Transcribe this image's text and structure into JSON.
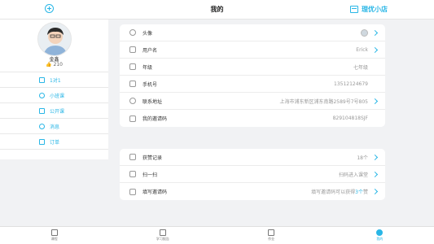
{
  "header": {
    "title": "我的",
    "shop_label": "理优小店"
  },
  "profile": {
    "name": "金鑫",
    "likes": "210"
  },
  "menu": [
    {
      "label": "1对1",
      "icon": "people-icon"
    },
    {
      "label": "小班课",
      "icon": "group-icon"
    },
    {
      "label": "公开课",
      "icon": "broadcast-icon"
    },
    {
      "label": "消息",
      "icon": "chat-icon"
    },
    {
      "label": "订单",
      "icon": "order-icon"
    }
  ],
  "info_rows": [
    {
      "label": "头像",
      "value": "",
      "icon": "user-icon"
    },
    {
      "label": "用户名",
      "value": "Erick",
      "icon": "id-card-icon"
    },
    {
      "label": "年级",
      "value": "七年级",
      "icon": "grade-icon"
    },
    {
      "label": "手机号",
      "value": "13512124679",
      "icon": "phone-icon"
    },
    {
      "label": "联系地址",
      "value": "上海市浦东新区浦东南路2589号7号805",
      "icon": "location-icon"
    },
    {
      "label": "我的邀请码",
      "value": "829104818SJF",
      "icon": "send-icon"
    }
  ],
  "action_rows": [
    {
      "label": "获赞记录",
      "value": "18个",
      "icon": "thumb-icon"
    },
    {
      "label": "扫一扫",
      "value": "扫码进入课堂",
      "icon": "scan-icon"
    },
    {
      "label": "填写邀请码",
      "value_pre": "填写邀请码可以获得",
      "value_hl": "3个",
      "value_post": "赞",
      "icon": "key-icon"
    }
  ],
  "tabs": [
    {
      "label": "课程"
    },
    {
      "label": "学习报告"
    },
    {
      "label": "作业"
    },
    {
      "label": "我的"
    }
  ],
  "colors": {
    "accent": "#29b6e6",
    "background": "#f1f2f4"
  }
}
